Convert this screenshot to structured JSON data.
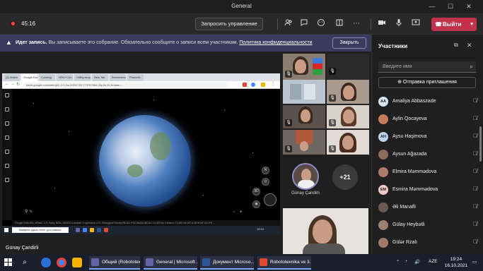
{
  "window": {
    "title": "General",
    "minimize": "—",
    "maximize": "☐",
    "close": "✕"
  },
  "toolbar": {
    "timer": "45:16",
    "share_control": "Запросить управление",
    "leave_label": "Выйти"
  },
  "banner": {
    "bold": "Идет запись.",
    "text": "Вы записываете это собрание. Обязательно сообщите о записи всем участникам.",
    "link": "Политика конфиденциальности",
    "close": "Закрыть"
  },
  "browser": {
    "tabs": [
      "(2) Watch",
      "Google Earth",
      "Coloring",
      "GRU+Con",
      "Лабораторн",
      "New Tab",
      "Бесплатно",
      "Phonefix"
    ],
    "url": "earth.google.com/web/@0,-0.0,0a,22251752.77375798d,35y,0h,0t,0r/data=...",
    "bottom_bar": "Google   Data SIO, NOAA, U.S. Navy, NGA, GEBCO  Landsat / Copernicus  U.S. Geological Survey  IBCAO  PGC/NASA  IBCAO      10,000 km   Camera: 23,382 km   60°11'28\"N 56°16'13\"E   ...",
    "search_placeholder": "Введите здесь текст для поиска",
    "inner_clock": "19:24"
  },
  "stage": {
    "presenter_name": "Günay Çandirli"
  },
  "gallery": {
    "avatar_name": "Günay Çandirli",
    "more_count": "+21"
  },
  "panel": {
    "title": "Участники",
    "search_placeholder": "Введите имя",
    "invite": "Отправка приглашения",
    "participants": [
      {
        "initials": "AA",
        "name": "Amaliya Abbaszade",
        "color": "#d6e4f5"
      },
      {
        "initials": "",
        "name": "Aylin Qocayeva",
        "color": "#c77a5a"
      },
      {
        "initials": "AH",
        "name": "Aysu Haşimova",
        "color": "#bcd3ea"
      },
      {
        "initials": "",
        "name": "Aysun Ağazada",
        "color": "#8a6d5b"
      },
      {
        "initials": "",
        "name": "Elmira Məmmədova",
        "color": "#b07c6a"
      },
      {
        "initials": "EM",
        "name": "Esmira Məmmədova",
        "color": "#f3c9c9"
      },
      {
        "initials": "",
        "name": "Əli Manafli",
        "color": "#6a5a50"
      },
      {
        "initials": "",
        "name": "Gülay Heybətli",
        "color": "#9a8270"
      },
      {
        "initials": "",
        "name": "Gülər Rzalı",
        "color": "#a07a68"
      }
    ]
  },
  "taskbar": {
    "apps": [
      {
        "label": "Общий (Robototex...",
        "color": "#6264a7"
      },
      {
        "label": "General | Microsoft ...",
        "color": "#6264a7"
      },
      {
        "label": "Документ Microso...",
        "color": "#2b579a"
      },
      {
        "label": "Robototexnika ve 3...",
        "color": "#e04a2f"
      }
    ],
    "lang": "AZE",
    "time": "19:24",
    "date": "16.10.2021"
  },
  "colors": {
    "accent": "#6264a7",
    "leave": "#c4314b",
    "banner": "#3b3a5c"
  }
}
